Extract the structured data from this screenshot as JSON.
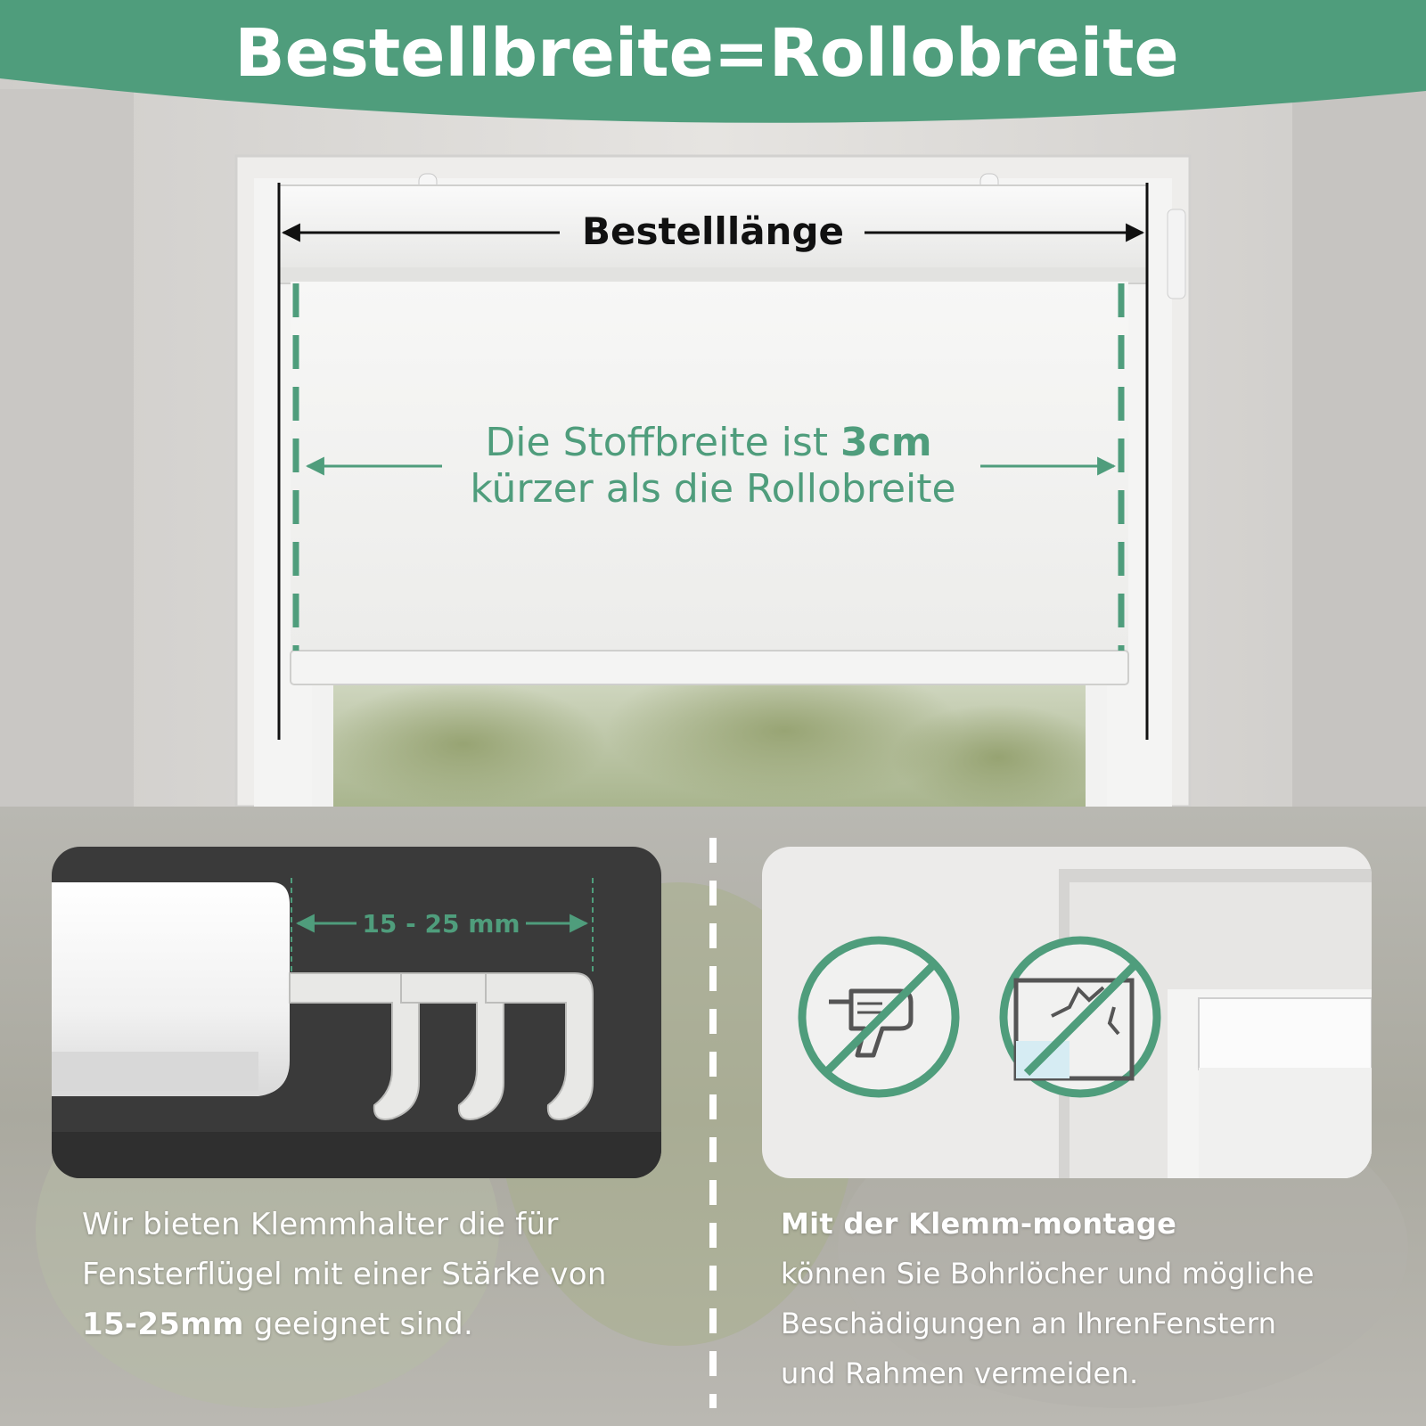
{
  "header": {
    "title": "Bestellbreite=Rollobreite"
  },
  "measure": {
    "order_length_label": "Bestelllänge",
    "fabric_note_line1_prefix": "Die Stoffbreite ist ",
    "fabric_note_line1_bold": "3cm",
    "fabric_note_line2": "kürzer als die Rollobreite"
  },
  "left_panel": {
    "range_label": "15 - 25 mm",
    "caption_line1": "Wir bieten Klemmhalter die für",
    "caption_line2": "Fensterflügel mit einer Stärke von",
    "caption_bold": "15-25mm",
    "caption_line3_rest": " geeignet sind."
  },
  "right_panel": {
    "caption_heading": "Mit der Klemm-montage",
    "caption_line1": "können Sie Bohrlöcher und mögliche",
    "caption_line2": "Beschädigungen an IhrenFenstern",
    "caption_line3": "und Rahmen vermeiden.",
    "icons": [
      "no-drill-icon",
      "no-broken-window-icon"
    ]
  },
  "colors": {
    "accent_green": "#4f9d7c",
    "black": "#111111",
    "white": "#ffffff"
  }
}
